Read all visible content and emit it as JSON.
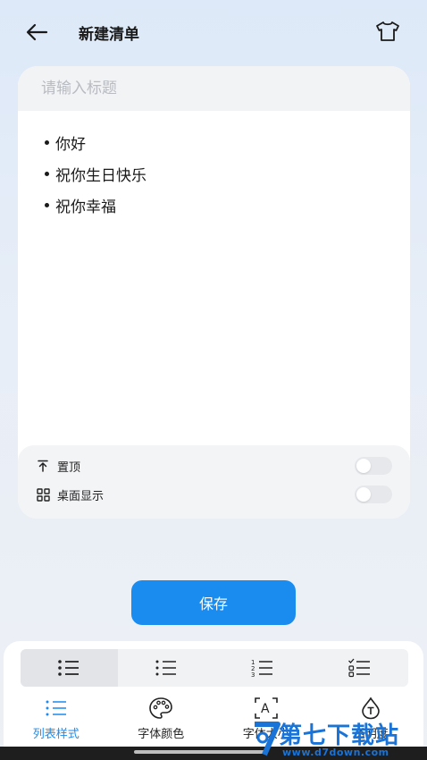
{
  "header": {
    "title": "新建清单"
  },
  "editor": {
    "title_placeholder": "请输入标题",
    "title_value": "",
    "items": [
      "你好",
      "祝你生日快乐",
      "祝你幸福"
    ]
  },
  "options": {
    "pin_label": "置顶",
    "pin_on": false,
    "desktop_label": "桌面显示",
    "desktop_on": false
  },
  "save_label": "保存",
  "toolbar": {
    "styles": [
      "bullet-list-icon",
      "bullet-list-alt-icon",
      "numbered-list-icon",
      "checklist-icon"
    ],
    "active_style": 0,
    "tabs": [
      {
        "label": "列表样式",
        "icon": "list-style-icon",
        "active": true
      },
      {
        "label": "字体颜色",
        "icon": "palette-icon",
        "active": false
      },
      {
        "label": "字体大小",
        "icon": "font-size-icon",
        "active": false
      },
      {
        "label": "透明度",
        "icon": "transparency-icon",
        "active": false
      }
    ]
  },
  "watermark": {
    "title": "第七下载站",
    "url": "www.d7down.com"
  },
  "colors": {
    "accent": "#1a8cf0",
    "watermark": "#1a73d6"
  }
}
